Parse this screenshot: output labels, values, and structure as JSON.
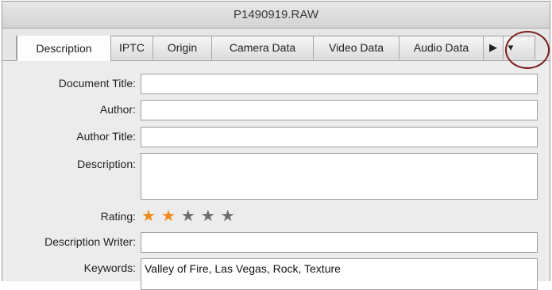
{
  "window": {
    "title": "P1490919.RAW"
  },
  "tabs": [
    {
      "label": "Description",
      "active": true
    },
    {
      "label": "IPTC"
    },
    {
      "label": "Origin"
    },
    {
      "label": "Camera Data"
    },
    {
      "label": "Video Data"
    },
    {
      "label": "Audio Data"
    }
  ],
  "tab_scroll": {
    "next_glyph": "▶",
    "menu_glyph": "▾"
  },
  "fields": {
    "document_title": {
      "label": "Document Title:",
      "value": ""
    },
    "author": {
      "label": "Author:",
      "value": ""
    },
    "author_title": {
      "label": "Author Title:",
      "value": ""
    },
    "description": {
      "label": "Description:",
      "value": ""
    },
    "rating": {
      "label": "Rating:",
      "value": 2,
      "max": 5,
      "star_glyph": "★"
    },
    "description_writer": {
      "label": "Description Writer:",
      "value": ""
    },
    "keywords": {
      "label": "Keywords:",
      "value": "Valley of Fire, Las Vegas, Rock, Texture"
    }
  },
  "colors": {
    "star_filled": "#f08a1c",
    "star_empty": "#6e6e6e",
    "highlight_circle": "#7a1e1e"
  }
}
